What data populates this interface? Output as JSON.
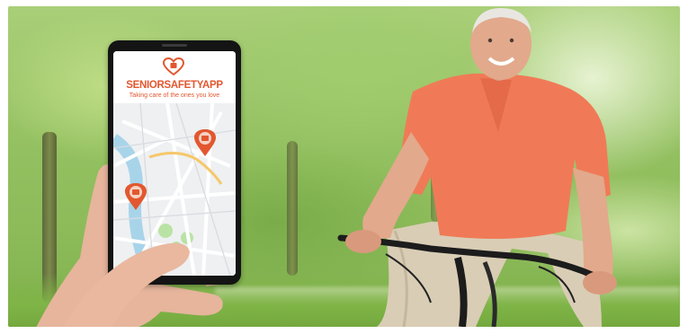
{
  "app": {
    "brand_part1": "SENIOR",
    "brand_part2": "SAFETY",
    "brand_part3": "APP",
    "tagline": "Taking care of the ones you love",
    "accent_color": "#e2572f"
  },
  "map": {
    "pins": [
      "location-pin-icon",
      "location-pin-icon"
    ]
  },
  "scene": {
    "subject": "senior man on bicycle",
    "background": "park trees"
  }
}
